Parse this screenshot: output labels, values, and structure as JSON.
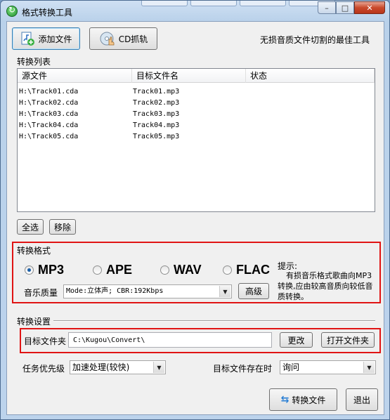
{
  "window": {
    "title": "格式转换工具",
    "controls": {
      "minimize": "–",
      "maximize": "□",
      "close": "✕"
    }
  },
  "toolbar": {
    "add_file": "添加文件",
    "cd_rip": "CD抓轨",
    "tagline": "无损音质文件切割的最佳工具"
  },
  "list": {
    "title": "转换列表",
    "columns": [
      "源文件",
      "目标文件名",
      "状态"
    ],
    "rows": [
      {
        "source": "H:\\Track01.cda",
        "target": "Track01.mp3",
        "status": ""
      },
      {
        "source": "H:\\Track02.cda",
        "target": "Track02.mp3",
        "status": ""
      },
      {
        "source": "H:\\Track03.cda",
        "target": "Track03.mp3",
        "status": ""
      },
      {
        "source": "H:\\Track04.cda",
        "target": "Track04.mp3",
        "status": ""
      },
      {
        "source": "H:\\Track05.cda",
        "target": "Track05.mp3",
        "status": ""
      }
    ],
    "select_all": "全选",
    "remove": "移除"
  },
  "format": {
    "title": "转换格式",
    "options": [
      "MP3",
      "APE",
      "WAV",
      "FLAC"
    ],
    "selected": "MP3",
    "quality_label": "音乐质量",
    "quality_value": "Mode:立体声; CBR:192Kbps",
    "advanced": "高级",
    "hint_title": "提示:",
    "hint_text": "有损音乐格式歌曲向MP3转换,应由较高音质向较低音质转换。"
  },
  "settings": {
    "title": "转换设置",
    "target_folder_label": "目标文件夹",
    "target_folder_value": "C:\\Kugou\\Convert\\",
    "change": "更改",
    "open_folder": "打开文件夹",
    "priority_label": "任务优先级",
    "priority_value": "加速处理(较快)",
    "exists_label": "目标文件存在时",
    "exists_value": "询问"
  },
  "footer": {
    "convert": "转换文件",
    "exit": "退出"
  },
  "colors": {
    "highlight_border": "#e01414",
    "dialog_bg": "#f0f0f0"
  }
}
